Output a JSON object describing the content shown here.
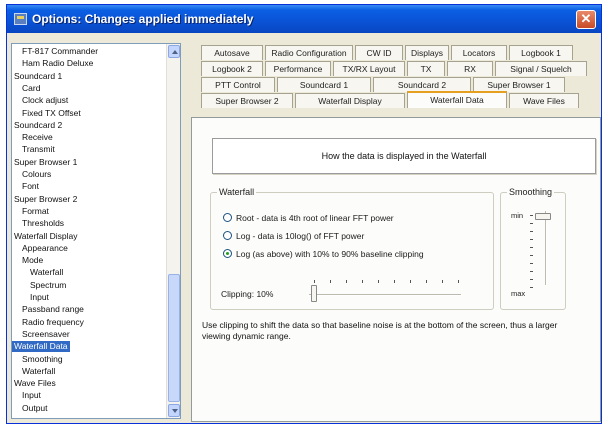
{
  "window": {
    "title": "Options: Changes applied immediately"
  },
  "tree": {
    "items": [
      {
        "label": "FT-817 Commander",
        "level": 1
      },
      {
        "label": "Ham Radio Deluxe",
        "level": 1
      },
      {
        "label": "Soundcard 1",
        "level": 0
      },
      {
        "label": "Card",
        "level": 1
      },
      {
        "label": "Clock adjust",
        "level": 1
      },
      {
        "label": "Fixed TX Offset",
        "level": 1
      },
      {
        "label": "Soundcard 2",
        "level": 0
      },
      {
        "label": "Receive",
        "level": 1
      },
      {
        "label": "Transmit",
        "level": 1
      },
      {
        "label": "Super Browser 1",
        "level": 0
      },
      {
        "label": "Colours",
        "level": 1
      },
      {
        "label": "Font",
        "level": 1
      },
      {
        "label": "Super Browser 2",
        "level": 0
      },
      {
        "label": "Format",
        "level": 1
      },
      {
        "label": "Thresholds",
        "level": 1
      },
      {
        "label": "Waterfall Display",
        "level": 0
      },
      {
        "label": "Appearance",
        "level": 1
      },
      {
        "label": "Mode",
        "level": 1
      },
      {
        "label": "Waterfall",
        "level": 2
      },
      {
        "label": "Spectrum",
        "level": 2
      },
      {
        "label": "Input",
        "level": 2
      },
      {
        "label": "Passband range",
        "level": 1
      },
      {
        "label": "Radio frequency",
        "level": 1
      },
      {
        "label": "Screensaver",
        "level": 1
      },
      {
        "label": "Waterfall Data",
        "level": 0,
        "selected": true
      },
      {
        "label": "Smoothing",
        "level": 1
      },
      {
        "label": "Waterfall",
        "level": 1
      },
      {
        "label": "Wave Files",
        "level": 0
      },
      {
        "label": "Input",
        "level": 1
      },
      {
        "label": "Output",
        "level": 1
      }
    ]
  },
  "tabs": {
    "row1": [
      "Autosave",
      "Radio Configuration",
      "CW ID",
      "Displays",
      "Locators",
      "Logbook 1"
    ],
    "row2": [
      "Logbook 2",
      "Performance",
      "TX/RX Layout",
      "TX",
      "RX",
      "Signal / Squelch"
    ],
    "row3": [
      "PTT Control",
      "Soundcard 1",
      "Soundcard 2",
      "Super Browser 1"
    ],
    "row4": [
      "Super Browser 2",
      "Waterfall Display",
      "Waterfall Data",
      "Wave Files"
    ],
    "active": "Waterfall Data"
  },
  "panel": {
    "info_button": "How the data is displayed in the Waterfall",
    "waterfall_group": "Waterfall",
    "options": [
      {
        "label": "Root - data is 4th root of linear FFT power",
        "selected": false
      },
      {
        "label": "Log - data is 10log() of FFT power",
        "selected": false
      },
      {
        "label": "Log (as above) with 10% to 90% baseline clipping",
        "selected": true
      }
    ],
    "clipping_label": "Clipping:",
    "clipping_value": "10%",
    "clipping_fraction": 0.0,
    "smoothing_group": "Smoothing",
    "smoothing_min": "min",
    "smoothing_max": "max",
    "smoothing_fraction": 0.0,
    "note": "Use clipping to shift the data so that baseline noise is at the bottom of the screen, thus a larger viewing dynamic range."
  }
}
